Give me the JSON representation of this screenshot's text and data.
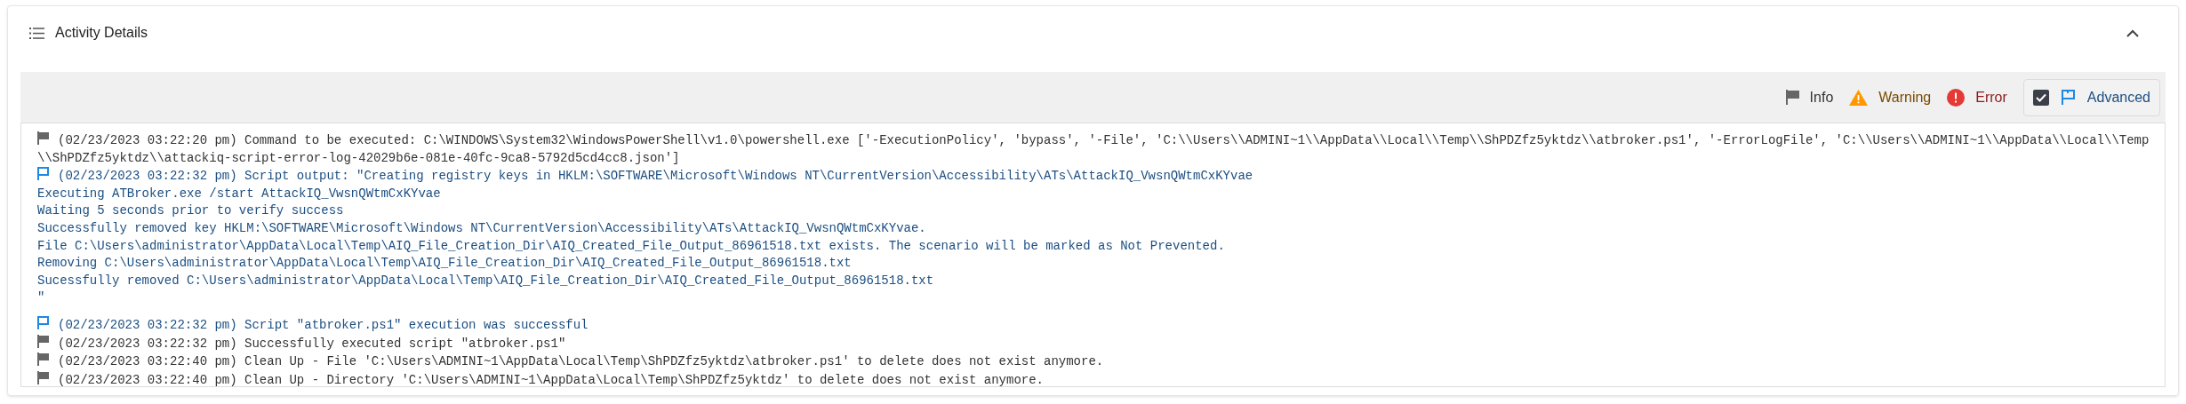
{
  "panel": {
    "title": "Activity Details",
    "expanded": true
  },
  "filters": [
    {
      "kind": "info",
      "label": "Info"
    },
    {
      "kind": "warning",
      "label": "Warning"
    },
    {
      "kind": "error",
      "label": "Error"
    },
    {
      "kind": "advanced",
      "label": "Advanced",
      "checked": true
    }
  ],
  "log": [
    {
      "kind": "info",
      "lines": [
        "(02/23/2023 03:22:20 pm) Command to be executed: C:\\WINDOWS\\System32\\WindowsPowerShell\\v1.0\\powershell.exe ['-ExecutionPolicy', 'bypass', '-File', 'C:\\\\Users\\\\ADMINI~1\\\\AppData\\\\Local\\\\Temp\\\\ShPDZfz5yktdz\\\\atbroker.ps1', '-ErrorLogFile', 'C:\\\\Users\\\\ADMINI~1\\\\AppData\\\\Local\\\\Temp",
        "\\\\ShPDZfz5yktdz\\\\attackiq-script-error-log-42029b6e-081e-40fc-9ca8-5792d5cd4cc8.json']"
      ]
    },
    {
      "kind": "advanced",
      "lines": [
        "(02/23/2023 03:22:32 pm) Script output: \"Creating registry keys in HKLM:\\SOFTWARE\\Microsoft\\Windows NT\\CurrentVersion\\Accessibility\\ATs\\AttackIQ_VwsnQWtmCxKYvae",
        "Executing ATBroker.exe /start AttackIQ_VwsnQWtmCxKYvae",
        "Waiting 5 seconds prior to verify success",
        "Successfully removed key HKLM:\\SOFTWARE\\Microsoft\\Windows NT\\CurrentVersion\\Accessibility\\ATs\\AttackIQ_VwsnQWtmCxKYvae.",
        "File C:\\Users\\administrator\\AppData\\Local\\Temp\\AIQ_File_Creation_Dir\\AIQ_Created_File_Output_86961518.txt exists. The scenario will be marked as Not Prevented.",
        "Removing C:\\Users\\administrator\\AppData\\Local\\Temp\\AIQ_File_Creation_Dir\\AIQ_Created_File_Output_86961518.txt",
        "Sucessfully removed C:\\Users\\administrator\\AppData\\Local\\Temp\\AIQ_File_Creation_Dir\\AIQ_Created_File_Output_86961518.txt",
        "\""
      ]
    },
    {
      "kind": "advanced",
      "lines": [
        "(02/23/2023 03:22:32 pm) Script \"atbroker.ps1\" execution was successful"
      ]
    },
    {
      "kind": "info",
      "lines": [
        "(02/23/2023 03:22:32 pm) Successfully executed script \"atbroker.ps1\""
      ]
    },
    {
      "kind": "info",
      "lines": [
        "(02/23/2023 03:22:40 pm) Clean Up - File 'C:\\Users\\ADMINI~1\\AppData\\Local\\Temp\\ShPDZfz5yktdz\\atbroker.ps1' to delete does not exist anymore."
      ]
    },
    {
      "kind": "info",
      "lines": [
        "(02/23/2023 03:22:40 pm) Clean Up - Directory 'C:\\Users\\ADMINI~1\\AppData\\Local\\Temp\\ShPDZfz5yktdz' to delete does not exist anymore."
      ]
    }
  ]
}
